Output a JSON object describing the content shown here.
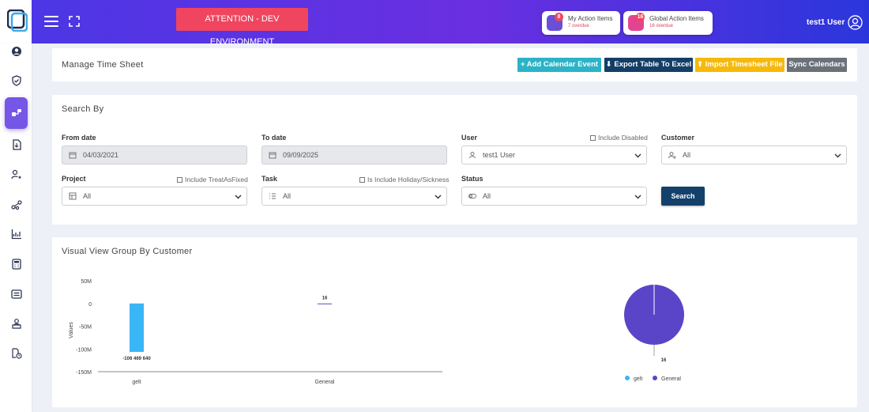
{
  "header": {
    "attention": "ATTENTION - DEV ENVIRONMENT",
    "my_action": {
      "title": "My Action Items",
      "sub": "7 overdue",
      "badge": "8"
    },
    "global_action": {
      "title": "Global Action Items",
      "sub": "16 overdue",
      "badge": "16"
    },
    "user": "test1 User"
  },
  "sidebar": {
    "items": [
      "user-circle-icon",
      "shield-check-icon",
      "workflow-icon",
      "document-icon",
      "user-star-icon",
      "share-nodes-icon",
      "chart-line-icon",
      "calculator-icon",
      "list-icon",
      "person-desk-icon",
      "doc-clock-icon"
    ]
  },
  "toolbar": {
    "title": "Manage Time Sheet",
    "add": "+ Add Calendar Event",
    "export": "⬇ Export Table To Excel",
    "import": "⬆ Import Timesheet File",
    "sync": "Sync Calendars"
  },
  "search": {
    "title": "Search By",
    "from_label": "From date",
    "from_value": "04/03/2021",
    "to_label": "To date",
    "to_value": "09/09/2025",
    "user_label": "User",
    "user_value": "test1 User",
    "include_disabled": "Include Disabled",
    "customer_label": "Customer",
    "customer_value": "All",
    "project_label": "Project",
    "project_value": "All",
    "include_fixed": "Include TreatAsFixed",
    "task_label": "Task",
    "task_value": "All",
    "include_holiday": "Is Include Holiday/Sickness",
    "status_label": "Status",
    "status_value": "All",
    "search_button": "Search"
  },
  "visual": {
    "title": "Visual View Group By Customer"
  },
  "chart_data": [
    {
      "type": "bar",
      "categories": [
        "gelt",
        "General"
      ],
      "values": [
        -106469640,
        16
      ],
      "data_labels": [
        "-106 469 640",
        "16"
      ],
      "ylabel": "Values",
      "yticks": [
        50000000,
        0,
        -50000000,
        -100000000,
        -150000000
      ],
      "ytick_labels": [
        "50M",
        "0",
        "-50M",
        "-100M",
        "-150M"
      ],
      "ylim": [
        -150000000,
        50000000
      ],
      "colors": [
        "#3ab5f5",
        "#5a45c8"
      ]
    },
    {
      "type": "pie",
      "labels": [
        "gelt",
        "General"
      ],
      "values": [
        0,
        16
      ],
      "data_label": "16",
      "colors": [
        "#3ab5f5",
        "#5a45c8"
      ],
      "legend": "bottom"
    }
  ]
}
